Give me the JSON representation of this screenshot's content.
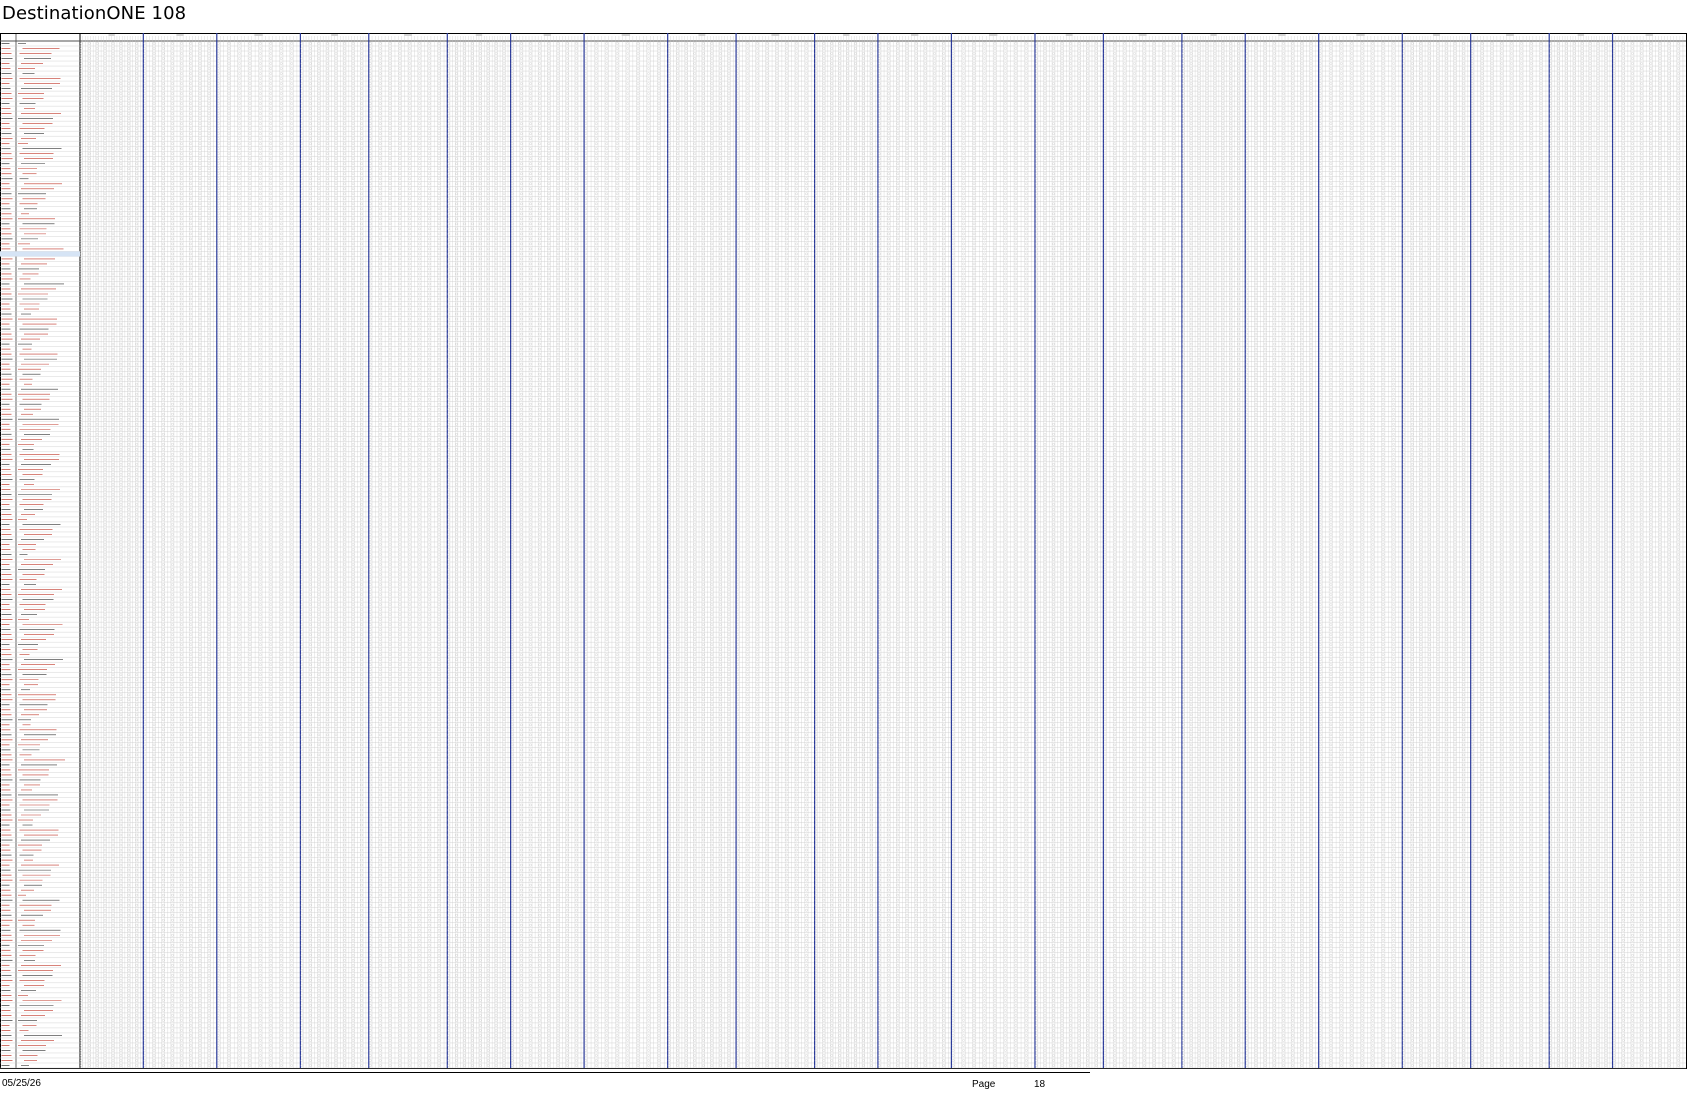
{
  "document": {
    "title": "DestinationONE 108"
  },
  "footer": {
    "date": "05/25/26",
    "page_label": "Page",
    "page_number": "18"
  },
  "grid": {
    "row_count": 205,
    "column_groups": 22,
    "colors": {
      "grid_line": "#c9c9c9",
      "group_divider": "#2a3a9a",
      "red_text": "#c0392b",
      "dark_text": "#333333",
      "highlight_row": "#d6e4f5"
    }
  }
}
